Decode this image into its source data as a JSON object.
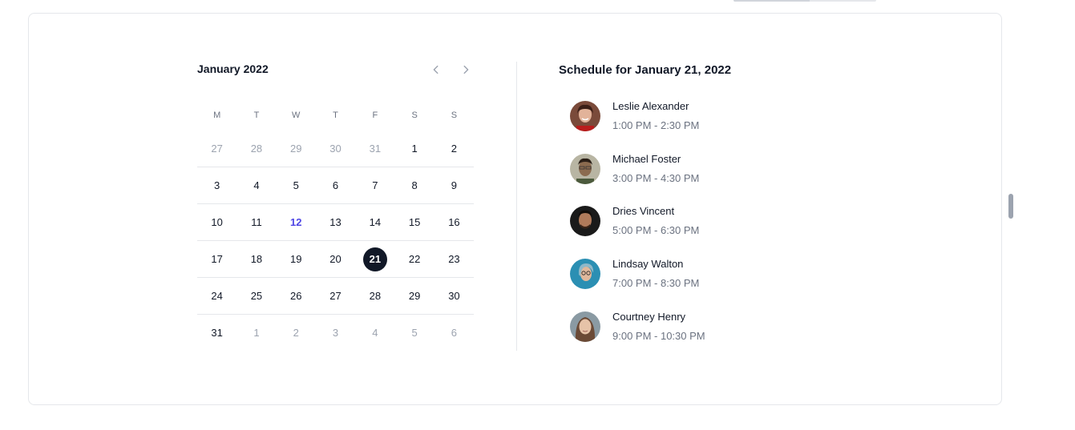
{
  "calendar": {
    "month_label": "January 2022",
    "prev_icon": "chevron-left-icon",
    "next_icon": "chevron-right-icon",
    "weekdays": [
      "M",
      "T",
      "W",
      "T",
      "F",
      "S",
      "S"
    ],
    "weeks": [
      [
        {
          "d": "27",
          "m": true
        },
        {
          "d": "28",
          "m": true
        },
        {
          "d": "29",
          "m": true
        },
        {
          "d": "30",
          "m": true
        },
        {
          "d": "31",
          "m": true
        },
        {
          "d": "1"
        },
        {
          "d": "2"
        }
      ],
      [
        {
          "d": "3"
        },
        {
          "d": "4"
        },
        {
          "d": "5"
        },
        {
          "d": "6"
        },
        {
          "d": "7"
        },
        {
          "d": "8"
        },
        {
          "d": "9"
        }
      ],
      [
        {
          "d": "10"
        },
        {
          "d": "11"
        },
        {
          "d": "12",
          "today": true
        },
        {
          "d": "13"
        },
        {
          "d": "14"
        },
        {
          "d": "15"
        },
        {
          "d": "16"
        }
      ],
      [
        {
          "d": "17"
        },
        {
          "d": "18"
        },
        {
          "d": "19"
        },
        {
          "d": "20"
        },
        {
          "d": "21",
          "selected": true
        },
        {
          "d": "22"
        },
        {
          "d": "23"
        }
      ],
      [
        {
          "d": "24"
        },
        {
          "d": "25"
        },
        {
          "d": "26"
        },
        {
          "d": "27"
        },
        {
          "d": "28"
        },
        {
          "d": "29"
        },
        {
          "d": "30"
        }
      ],
      [
        {
          "d": "31"
        },
        {
          "d": "1",
          "m": true
        },
        {
          "d": "2",
          "m": true
        },
        {
          "d": "3",
          "m": true
        },
        {
          "d": "4",
          "m": true
        },
        {
          "d": "5",
          "m": true
        },
        {
          "d": "6",
          "m": true
        }
      ]
    ]
  },
  "schedule": {
    "title": "Schedule for January 21, 2022",
    "events": [
      {
        "name": "Leslie Alexander",
        "time": "1:00 PM - 2:30 PM",
        "avatar": "avatar-leslie"
      },
      {
        "name": "Michael Foster",
        "time": "3:00 PM - 4:30 PM",
        "avatar": "avatar-michael"
      },
      {
        "name": "Dries Vincent",
        "time": "5:00 PM - 6:30 PM",
        "avatar": "avatar-dries"
      },
      {
        "name": "Lindsay Walton",
        "time": "7:00 PM - 8:30 PM",
        "avatar": "avatar-lindsay"
      },
      {
        "name": "Courtney Henry",
        "time": "9:00 PM - 10:30 PM",
        "avatar": "avatar-courtney"
      }
    ]
  },
  "colors": {
    "accent": "#4f46e5",
    "selected_bg": "#111827",
    "muted_text": "#9ca3af",
    "border": "#e5e7eb"
  }
}
